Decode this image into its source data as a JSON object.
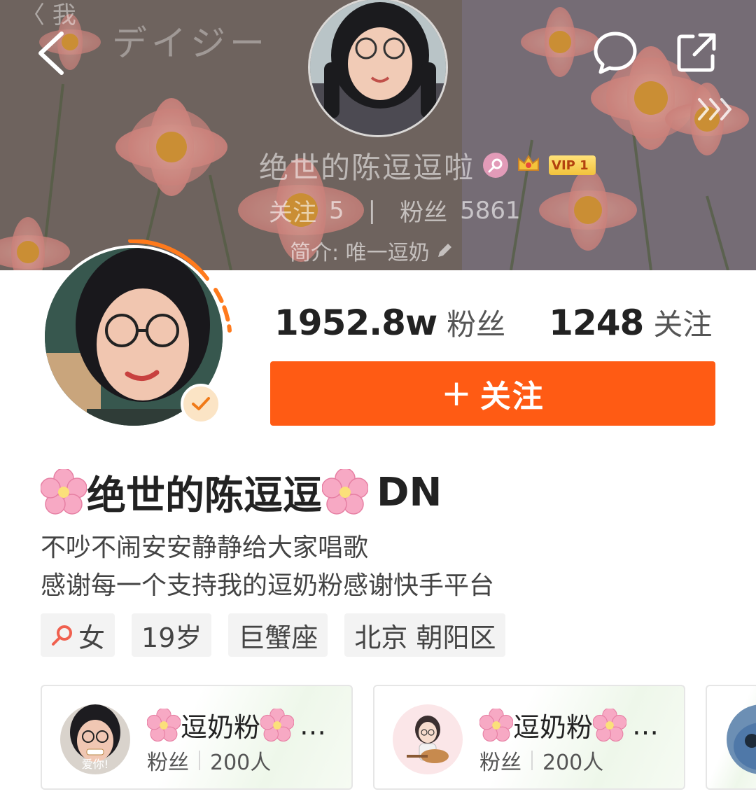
{
  "header": {
    "ghost_top_text": "〈 我",
    "watermark": "デイジー",
    "banner_name": "绝世的陈逗逗啦",
    "vip_label": "VIP 1",
    "following_label": "关注",
    "following_count": "5",
    "divider": "|",
    "fans_label": "粉丝",
    "fans_count": "5861",
    "bio": "简介: 唯一逗奶"
  },
  "profile": {
    "fans_count": "1952.8w",
    "fans_label": "粉丝",
    "following_count": "1248",
    "following_label": "关注",
    "follow_button_plus": "+",
    "follow_button_label": "关注",
    "display_name_main": "绝世的陈逗逗",
    "display_name_suffix": "DN",
    "bio_line1": "不吵不闹安安静静给大家唱歌",
    "bio_line2": "感谢每一个支持我的逗奶粉感谢快手平台",
    "tags": {
      "gender": "女",
      "age": "19岁",
      "zodiac": "巨蟹座",
      "location": "北京 朝阳区"
    }
  },
  "groups": [
    {
      "title_text": "逗奶粉",
      "ellipsis": "…",
      "members_label": "粉丝",
      "members_count": "200人",
      "avatar_caption": "爱你!"
    },
    {
      "title_text": "逗奶粉",
      "ellipsis": "…",
      "members_label": "粉丝",
      "members_count": "200人"
    }
  ],
  "colors": {
    "accent": "#ff5b14",
    "verified_badge": "#fbe4c5",
    "gender_pink": "#e29bb8",
    "vip_gold": "#f2c23c"
  },
  "icons": [
    "back-arrow-icon",
    "comment-icon",
    "share-icon",
    "more-arrows-icon",
    "female-icon",
    "crown-icon",
    "edit-pencil-icon",
    "checkmark-icon",
    "cherry-blossom-icon"
  ]
}
